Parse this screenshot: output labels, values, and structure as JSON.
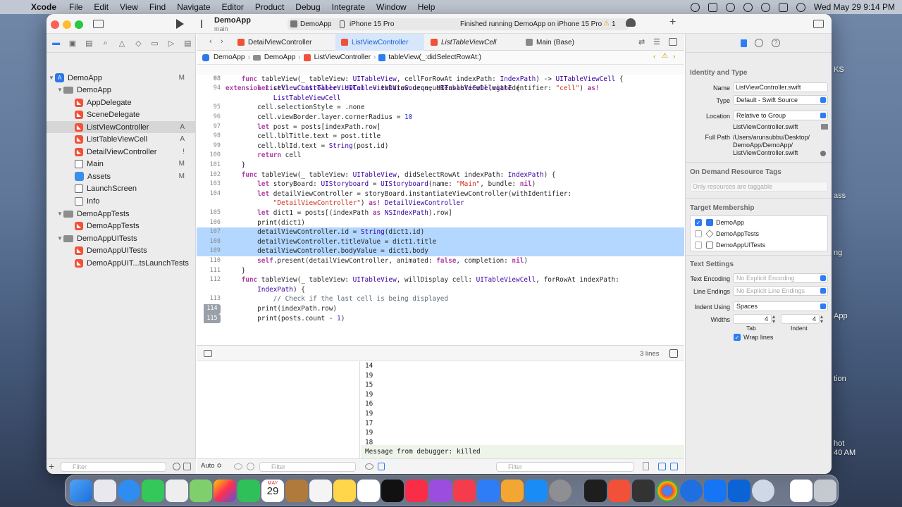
{
  "menubar": {
    "app_name": "Xcode",
    "items": [
      "File",
      "Edit",
      "View",
      "Find",
      "Navigate",
      "Editor",
      "Product",
      "Debug",
      "Integrate",
      "Window",
      "Help"
    ],
    "clock": "Wed May 29  9:14 PM"
  },
  "toolbar": {
    "project_name": "DemoApp",
    "branch": "main",
    "scheme": "DemoApp",
    "destination": "iPhone 15 Pro",
    "status": "Finished running DemoApp on iPhone 15 Pro",
    "warning_count": "1"
  },
  "navigator": {
    "items": [
      {
        "label": "DemoApp",
        "badge": "M"
      },
      {
        "label": "DemoApp",
        "badge": ""
      },
      {
        "label": "AppDelegate",
        "badge": ""
      },
      {
        "label": "SceneDelegate",
        "badge": ""
      },
      {
        "label": "ListViewController",
        "badge": "A"
      },
      {
        "label": "ListTableViewCell",
        "badge": "A"
      },
      {
        "label": "DetailViewController",
        "badge": "!"
      },
      {
        "label": "Main",
        "badge": "M"
      },
      {
        "label": "Assets",
        "badge": "M"
      },
      {
        "label": "LaunchScreen",
        "badge": ""
      },
      {
        "label": "Info",
        "badge": ""
      },
      {
        "label": "DemoAppTests",
        "badge": ""
      },
      {
        "label": "DemoAppTests",
        "badge": ""
      },
      {
        "label": "DemoAppUITests",
        "badge": ""
      },
      {
        "label": "DemoAppUITests",
        "badge": ""
      },
      {
        "label": "DemoAppUIT...tsLaunchTests",
        "badge": ""
      }
    ],
    "filter_placeholder": "Filter"
  },
  "tabs": [
    {
      "label": "DetailViewController"
    },
    {
      "label": "ListViewController"
    },
    {
      "label": "ListTableViewCell"
    },
    {
      "label": "Main (Base)"
    }
  ],
  "jumpbar": {
    "crumbs": [
      "DemoApp",
      "DemoApp",
      "ListViewController",
      "tableView(_:didSelectRowAt:)"
    ]
  },
  "code": {
    "sticky_ln": "88",
    "lines": [
      {
        "ln": "93",
        "text": "    func tableView(_ tableView: UITableView, cellForRowAt indexPath: IndexPath) -> UITableViewCell {"
      },
      {
        "ln": "94",
        "text": "        let cell : ListTableViewCell = tblView.dequeueReusableCell(withIdentifier: \"cell\") as!"
      },
      {
        "ln": "",
        "text": "            ListTableViewCell"
      },
      {
        "ln": "95",
        "text": "        cell.selectionStyle = .none"
      },
      {
        "ln": "96",
        "text": "        cell.viewBorder.layer.cornerRadius = 10"
      },
      {
        "ln": "97",
        "text": "        let post = posts[indexPath.row]"
      },
      {
        "ln": "98",
        "text": "        cell.lblTitle.text = post.title"
      },
      {
        "ln": "99",
        "text": "        cell.lblId.text = String(post.id)"
      },
      {
        "ln": "100",
        "text": "        return cell"
      },
      {
        "ln": "101",
        "text": "    }"
      },
      {
        "ln": "102",
        "text": "    func tableView(_ tableView: UITableView, didSelectRowAt indexPath: IndexPath) {"
      },
      {
        "ln": "103",
        "text": "        let storyBoard: UIStoryboard = UIStoryboard(name: \"Main\", bundle: nil)"
      },
      {
        "ln": "104",
        "text": "        let detailViewController = storyBoard.instantiateViewController(withIdentifier:"
      },
      {
        "ln": "",
        "text": "            \"DetailViewController\") as! DetailViewController"
      },
      {
        "ln": "105",
        "text": "        let dict1 = posts[(indexPath as NSIndexPath).row]"
      },
      {
        "ln": "106",
        "text": "        print(dict1)"
      },
      {
        "ln": "107",
        "text": "        detailViewController.id = String(dict1.id)"
      },
      {
        "ln": "108",
        "text": "        detailViewController.titleValue = dict1.title"
      },
      {
        "ln": "109",
        "text": "        detailViewController.bodyValue = dict1.body"
      },
      {
        "ln": "110",
        "text": "        self.present(detailViewController, animated: false, completion: nil)"
      },
      {
        "ln": "111",
        "text": "    }"
      },
      {
        "ln": "112",
        "text": "    func tableView(_ tableView: UITableView, willDisplay cell: UITableViewCell, forRowAt indexPath:"
      },
      {
        "ln": "",
        "text": "        IndexPath) {"
      },
      {
        "ln": "113",
        "text": "            // Check if the last cell is being displayed"
      },
      {
        "ln": "114",
        "text": "        print(indexPath.row)"
      },
      {
        "ln": "115",
        "text": "        print(posts.count - 1)"
      }
    ],
    "sticky_text": "extension ListViewController: UITableViewDataSource, UITableViewDelegate {"
  },
  "debug": {
    "lines_count": "3 lines",
    "console": [
      "14",
      "19",
      "15",
      "19",
      "16",
      "19",
      "17",
      "19",
      "18",
      "19"
    ],
    "message": "Message from debugger: killed",
    "auto_label": "Auto ≎",
    "filter_placeholder": "Filter"
  },
  "inspector": {
    "identity_header": "Identity and Type",
    "name_label": "Name",
    "name_value": "ListViewController.swift",
    "type_label": "Type",
    "type_value": "Default - Swift Source",
    "location_label": "Location",
    "location_value": "Relative to Group",
    "location_file": "ListViewController.swift",
    "full_path_label": "Full Path",
    "full_path_value_1": "/Users/arunsubbu/Desktop/",
    "full_path_value_2": "DemoApp/DemoApp/",
    "full_path_value_3": "ListViewController.swift",
    "odr_header": "On Demand Resource Tags",
    "odr_placeholder": "Only resources are taggable",
    "target_header": "Target Membership",
    "targets": [
      {
        "label": "DemoApp",
        "checked": true
      },
      {
        "label": "DemoAppTests",
        "checked": false
      },
      {
        "label": "DemoAppUITests",
        "checked": false
      }
    ],
    "text_header": "Text Settings",
    "encoding_label": "Text Encoding",
    "encoding_value": "No Explicit Encoding",
    "endings_label": "Line Endings",
    "endings_value": "No Explicit Line Endings",
    "indent_label": "Indent Using",
    "indent_value": "Spaces",
    "widths_label": "Widths",
    "tab_value": "4",
    "indent_width_value": "4",
    "tab_caption": "Tab",
    "indent_caption": "Indent",
    "wrap_label": "Wrap lines"
  },
  "desktop": {
    "labels": [
      "KS",
      "ass",
      "ng",
      "App",
      "tion",
      "hot",
      "40 AM"
    ]
  },
  "dock": {
    "calendar_month": "MAY",
    "calendar_day": "29"
  },
  "colors": {
    "accent": "#2d7cf6",
    "selection": "#b3d7ff",
    "keyword": "#ad3da4",
    "swift": "#f05138"
  }
}
